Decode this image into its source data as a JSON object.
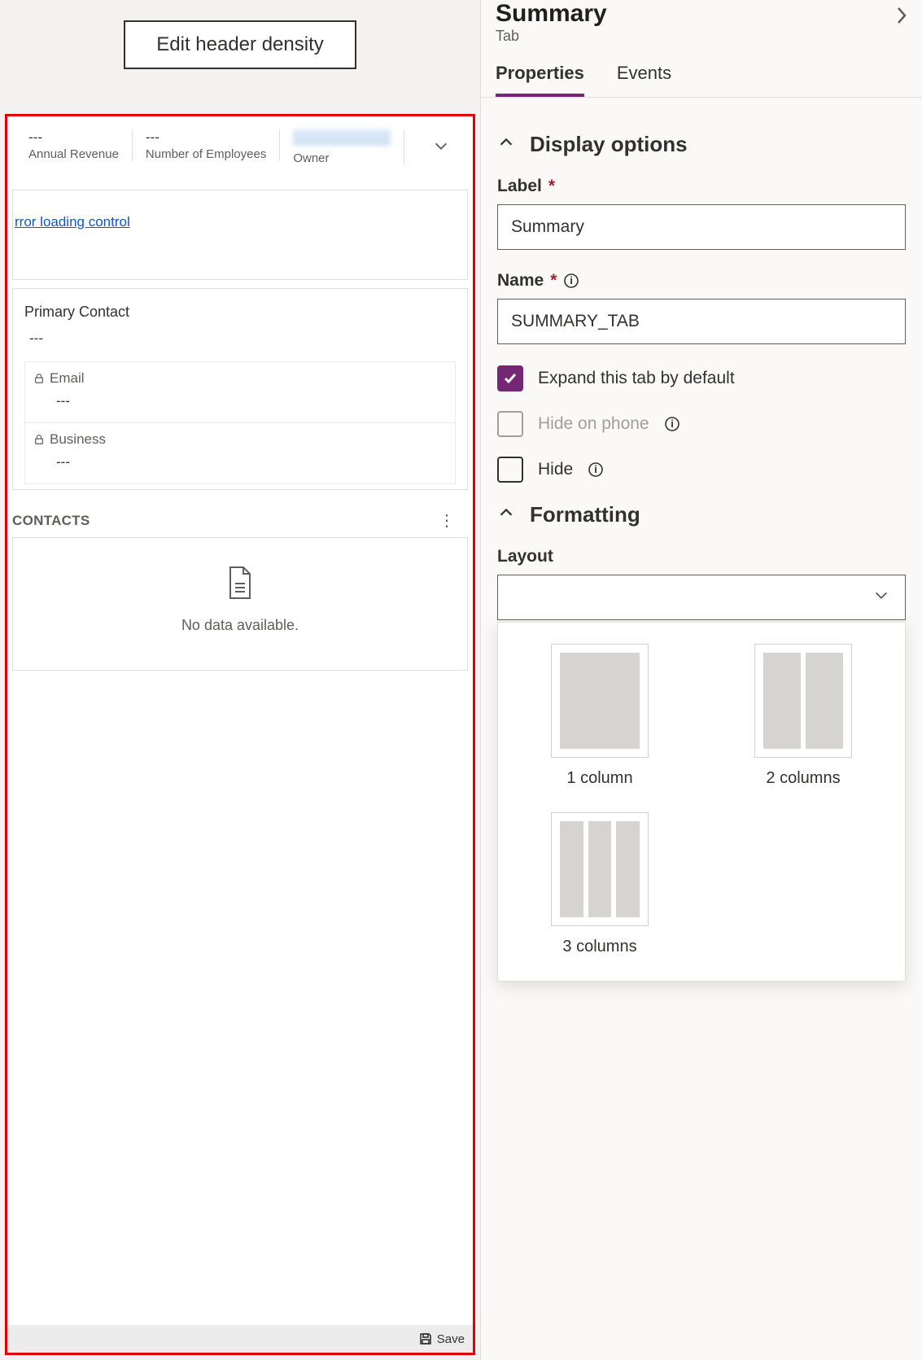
{
  "toolbar": {
    "edit_density": "Edit header density"
  },
  "header_fields": {
    "revenue": {
      "value": "---",
      "label": "Annual Revenue"
    },
    "employees": {
      "value": "---",
      "label": "Number of Employees"
    },
    "owner": {
      "value": "",
      "label": "Owner"
    }
  },
  "form": {
    "error_link": "rror loading control",
    "primary_contact_label": "Primary Contact",
    "primary_contact_value": "---",
    "email_label": "Email",
    "email_value": "---",
    "business_label": "Business",
    "business_value": "---",
    "contacts_section": "CONTACTS",
    "empty_text": "No data available.",
    "save": "Save"
  },
  "panel": {
    "title": "Summary",
    "type": "Tab",
    "tabs": {
      "properties": "Properties",
      "events": "Events"
    },
    "display_options": "Display options",
    "label_field": "Label",
    "label_value": "Summary",
    "name_field": "Name",
    "name_value": "SUMMARY_TAB",
    "expand_default": "Expand this tab by default",
    "hide_phone": "Hide on phone",
    "hide": "Hide",
    "formatting": "Formatting",
    "layout": "Layout",
    "layout_opts": {
      "one": "1 column",
      "two": "2 columns",
      "three": "3 columns"
    }
  }
}
